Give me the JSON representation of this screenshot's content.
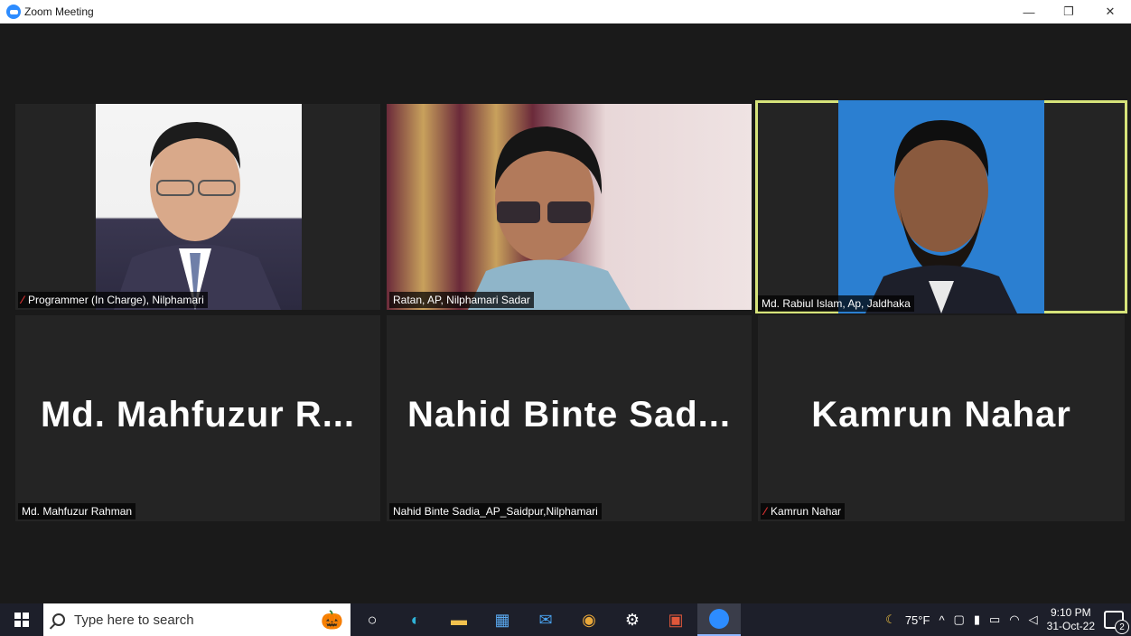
{
  "window": {
    "title": "Zoom Meeting",
    "minimize": "—",
    "restore": "❐",
    "close": "✕"
  },
  "participants": [
    {
      "label": "Programmer (In Charge), Nilphamari",
      "muted": true,
      "video": true
    },
    {
      "label": "Ratan, AP, Nilphamari Sadar",
      "muted": false,
      "video": true
    },
    {
      "label": "Md. Rabiul Islam, Ap, Jaldhaka",
      "muted": false,
      "video": true,
      "active_speaker": true
    },
    {
      "label": "Md. Mahfuzur Rahman",
      "display": "Md. Mahfuzur R...",
      "muted": false,
      "video": false
    },
    {
      "label": "Nahid Binte Sadia_AP_Saidpur,Nilphamari",
      "display": "Nahid Binte Sad...",
      "muted": false,
      "video": false
    },
    {
      "label": "Kamrun Nahar",
      "display": "Kamrun Nahar",
      "muted": true,
      "video": false
    }
  ],
  "taskbar": {
    "search_placeholder": "Type here to search",
    "apps": [
      "cortana-icon",
      "edge-icon",
      "file-explorer-icon",
      "store-icon",
      "mail-icon",
      "chrome-icon",
      "settings-icon",
      "powerpoint-icon",
      "zoom-icon"
    ],
    "weather": "75°F",
    "time": "9:10 PM",
    "date": "31-Oct-22",
    "notifications": "2"
  },
  "colors": {
    "active_border": "#d6e37a",
    "tile_bg": "#242424",
    "muted": "#e03232"
  }
}
